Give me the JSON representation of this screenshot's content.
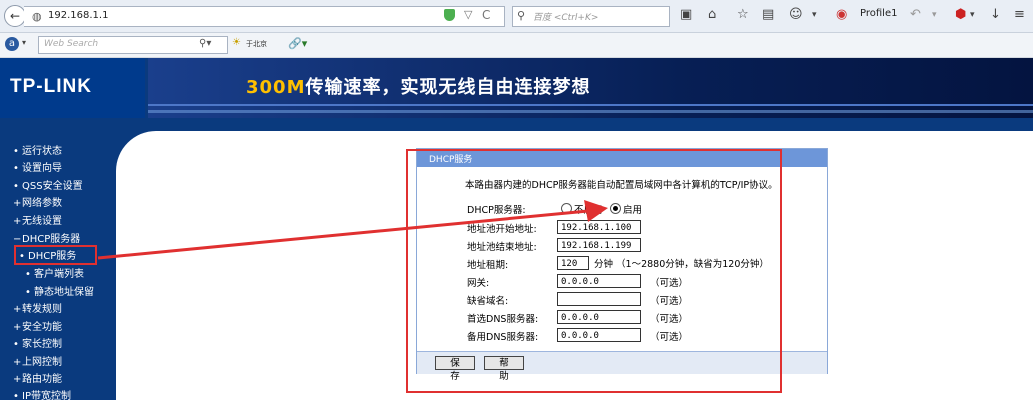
{
  "browser": {
    "url": "192.168.1.1",
    "search_placeholder": "百度 <Ctrl+K>",
    "profile": "Profile1",
    "web_search_placeholder": "Web Search",
    "weather_text": "于北京"
  },
  "header": {
    "logo": "TP-LINK",
    "banner_highlight": "300M",
    "banner_rest": "传输速率，实现无线自由连接梦想"
  },
  "sidebar": {
    "items": [
      {
        "label": "运行状态",
        "bullet": "•"
      },
      {
        "label": "设置向导",
        "bullet": "•"
      },
      {
        "label": "QSS安全设置",
        "bullet": "•"
      },
      {
        "label": "网络参数",
        "bullet": "+"
      },
      {
        "label": "无线设置",
        "bullet": "+"
      },
      {
        "label": "DHCP服务器",
        "bullet": "−"
      },
      {
        "label": "DHCP服务",
        "bullet": "•"
      },
      {
        "label": "客户端列表",
        "bullet": "•"
      },
      {
        "label": "静态地址保留",
        "bullet": "•"
      },
      {
        "label": "转发规则",
        "bullet": "+"
      },
      {
        "label": "安全功能",
        "bullet": "+"
      },
      {
        "label": "家长控制",
        "bullet": "•"
      },
      {
        "label": "上网控制",
        "bullet": "+"
      },
      {
        "label": "路由功能",
        "bullet": "+"
      },
      {
        "label": "IP带宽控制",
        "bullet": "•"
      }
    ]
  },
  "dhcp": {
    "title": "DHCP服务",
    "description": "本路由器内建的DHCP服务器能自动配置局域网中各计算机的TCP/IP协议。",
    "server_label": "DHCP服务器:",
    "off_label": "不启用",
    "on_label": "启用",
    "start_label": "地址池开始地址:",
    "start_value": "192.168.1.100",
    "end_label": "地址池结束地址:",
    "end_value": "192.168.1.199",
    "lease_label": "地址租期:",
    "lease_value": "120",
    "lease_unit": "分钟 （1～2880分钟，缺省为120分钟）",
    "gateway_label": "网关:",
    "gateway_value": "0.0.0.0",
    "domain_label": "缺省域名:",
    "domain_value": "",
    "dns1_label": "首选DNS服务器:",
    "dns1_value": "0.0.0.0",
    "dns2_label": "备用DNS服务器:",
    "dns2_value": "0.0.0.0",
    "optional": "（可选）",
    "save": "保 存",
    "help": "帮 助"
  },
  "colors": {
    "router_blue": "#0a3a7e",
    "panel_title": "#6d96d9",
    "annotation_red": "#e03030",
    "banner_highlight": "#ffc000"
  }
}
